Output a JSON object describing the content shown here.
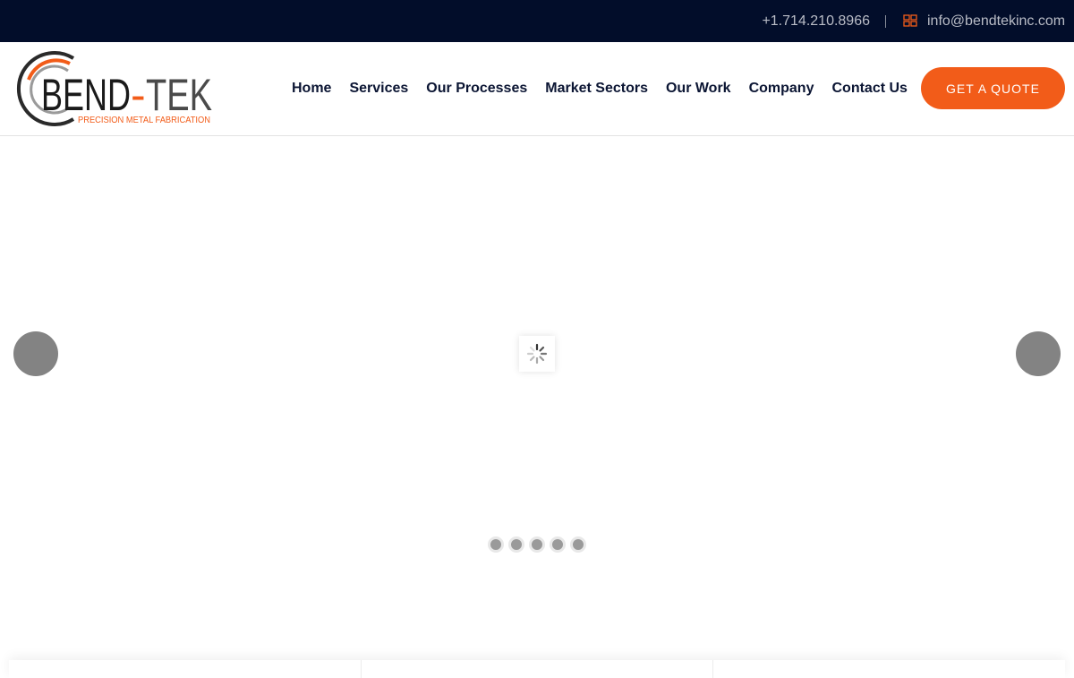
{
  "topbar": {
    "phone": "+1.714.210.8966",
    "email": "info@bendtekinc.com",
    "email_icon": "envelope-icon"
  },
  "logo": {
    "wordmark_left": "BEND",
    "wordmark_dash": "-",
    "wordmark_right": "TEK",
    "tagline": "PRECISION METAL FABRICATION"
  },
  "nav": {
    "items": [
      {
        "label": "Home"
      },
      {
        "label": "Services"
      },
      {
        "label": "Our Processes"
      },
      {
        "label": "Market Sectors"
      },
      {
        "label": "Our Work"
      },
      {
        "label": "Company"
      },
      {
        "label": "Contact Us"
      }
    ]
  },
  "cta": {
    "label": "GET A QUOTE"
  },
  "slider": {
    "prev_icon": "arrow-left-icon",
    "next_icon": "arrow-right-icon",
    "loading_icon": "spinner-icon",
    "dot_count": 5
  },
  "colors": {
    "topbar_bg": "#020d2a",
    "accent": "#f25c19",
    "nav_text": "#0b1533"
  }
}
